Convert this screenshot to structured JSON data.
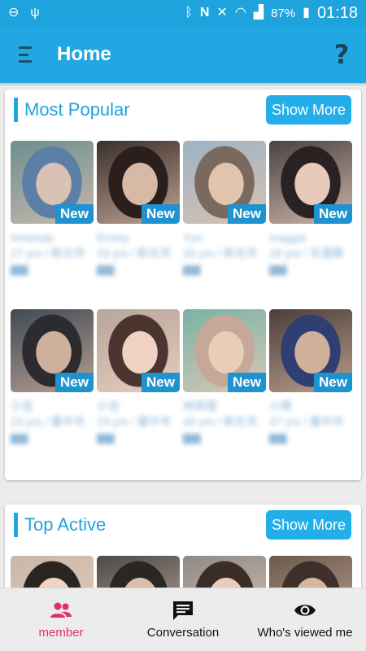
{
  "status_bar": {
    "battery": "87%",
    "time": "01:18"
  },
  "app_bar": {
    "title": "Home"
  },
  "most_popular": {
    "title": "Most Popular",
    "show_more": "Show More",
    "badge": "New",
    "tiles_row1": [
      {
        "colors": [
          "#6e8d8e",
          "#d9c2b4",
          "#5c7fa8"
        ]
      },
      {
        "colors": [
          "#3b2f2b",
          "#d8b9a6",
          "#2a1f1c"
        ]
      },
      {
        "colors": [
          "#9eb3c4",
          "#e2c4ae",
          "#7a6a5e"
        ]
      },
      {
        "colors": [
          "#4b4241",
          "#e6cbbd",
          "#2a2222"
        ]
      }
    ],
    "tiles_row2": [
      {
        "colors": [
          "#3f4a55",
          "#cfb09c",
          "#2b2b30"
        ]
      },
      {
        "colors": [
          "#b7a69a",
          "#f0d2c4",
          "#4a3531"
        ]
      },
      {
        "colors": [
          "#7ab2a6",
          "#e9cdb6",
          "#c6a79a"
        ]
      },
      {
        "colors": [
          "#4a3e3a",
          "#d1b09b",
          "#2f3f73"
        ]
      }
    ]
  },
  "top_active": {
    "title": "Top Active",
    "show_more": "Show More",
    "tiles": [
      {
        "colors": [
          "#c7b7a8",
          "#efd3c3",
          "#2a2420"
        ]
      },
      {
        "colors": [
          "#4d4a48",
          "#d9beae",
          "#2a2624"
        ]
      },
      {
        "colors": [
          "#8f8a86",
          "#e9cdbe",
          "#3a2d28"
        ]
      },
      {
        "colors": [
          "#6b5a4e",
          "#d5b6a1",
          "#3d2f2a"
        ]
      }
    ]
  },
  "bottom_nav": {
    "member": "member",
    "conversation": "Conversation",
    "viewed": "Who's viewed me"
  },
  "colors": {
    "primary": "#21a8e3",
    "accent": "#e0306c"
  }
}
